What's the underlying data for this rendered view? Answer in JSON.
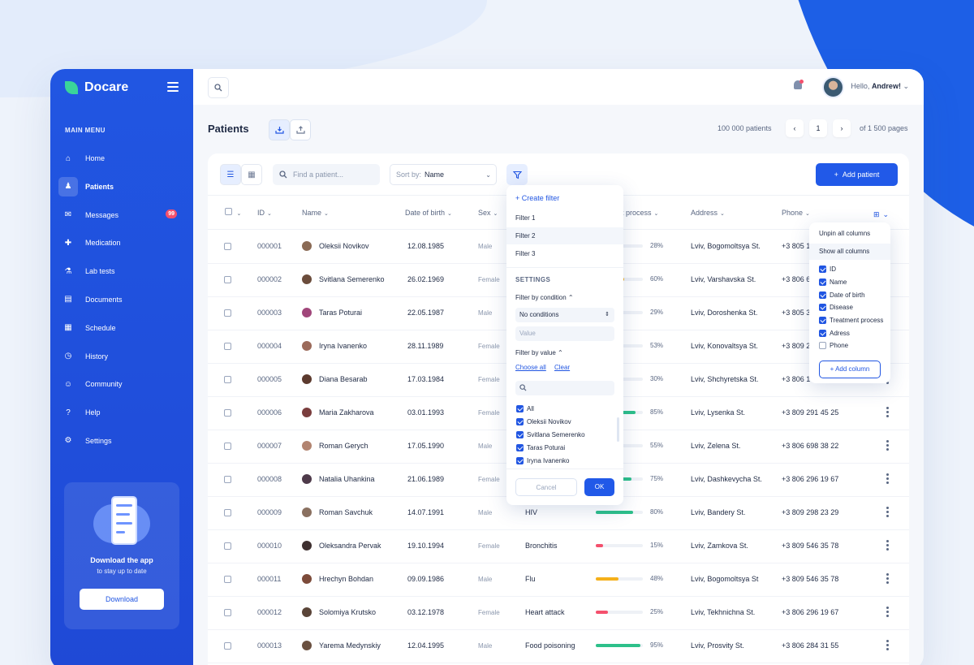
{
  "app": {
    "name": "Docare"
  },
  "sidebar": {
    "menu_title": "MAIN MENU",
    "items": [
      {
        "label": "Home",
        "icon": "home-icon",
        "glyph": "⌂"
      },
      {
        "label": "Patients",
        "icon": "patient-icon",
        "glyph": "♟",
        "active": true
      },
      {
        "label": "Messages",
        "icon": "mail-icon",
        "glyph": "✉",
        "badge": "99"
      },
      {
        "label": "Medication",
        "icon": "medication-icon",
        "glyph": "✚"
      },
      {
        "label": "Lab tests",
        "icon": "flask-icon",
        "glyph": "⚗"
      },
      {
        "label": "Documents",
        "icon": "document-icon",
        "glyph": "▤"
      },
      {
        "label": "Schedule",
        "icon": "calendar-icon",
        "glyph": "▦"
      },
      {
        "label": "History",
        "icon": "history-icon",
        "glyph": "◷"
      },
      {
        "label": "Community",
        "icon": "community-icon",
        "glyph": "☺"
      },
      {
        "label": "Help",
        "icon": "help-icon",
        "glyph": "?"
      },
      {
        "label": "Settings",
        "icon": "gear-icon",
        "glyph": "⚙"
      }
    ],
    "promo": {
      "title": "Download the app",
      "subtitle": "to stay up to date",
      "button": "Download"
    }
  },
  "topbar": {
    "greeting": "Hello,",
    "user": "Andrew!"
  },
  "page": {
    "title": "Patients",
    "count": "100 000 patients",
    "current_page": "1",
    "of_pages": "of 1 500 pages"
  },
  "toolbar": {
    "search_placeholder": "Find a patient...",
    "sort_label": "Sort by:",
    "sort_value": "Name",
    "add_button": "Add patient"
  },
  "table": {
    "columns": {
      "id": "ID",
      "name": "Name",
      "dob": "Date of birth",
      "sex": "Sex",
      "process": "nt process",
      "address": "Address",
      "phone": "Phone"
    },
    "rows": [
      {
        "id": "000001",
        "name": "Oleksii Novikov",
        "dob": "12.08.1985",
        "sex": "Male",
        "disease": "",
        "pct": 28,
        "pct_label": "28%",
        "color": "#f4506d",
        "address": "Lviv, Bogomoltsya St.",
        "phone": "+3 805 1",
        "ava": "#8a6a55"
      },
      {
        "id": "000002",
        "name": "Svitlana Semerenko",
        "dob": "26.02.1969",
        "sex": "Female",
        "disease": "",
        "pct": 60,
        "pct_label": "60%",
        "color": "#f5b01a",
        "address": "Lviv, Varshavska St.",
        "phone": "+3 806 6",
        "ava": "#6b4c3b"
      },
      {
        "id": "000003",
        "name": "Taras Poturai",
        "dob": "22.05.1987",
        "sex": "Male",
        "disease": "",
        "pct": 29,
        "pct_label": "29%",
        "color": "#f4506d",
        "address": "Lviv, Doroshenka St.",
        "phone": "+3 805 3",
        "ava": "#a0467a"
      },
      {
        "id": "000004",
        "name": "Iryna Ivanenko",
        "dob": "28.11.1989",
        "sex": "Female",
        "disease": "",
        "pct": 53,
        "pct_label": "53%",
        "color": "#f5b01a",
        "address": "Lviv, Konovaltsya St.",
        "phone": "+3 809 2",
        "ava": "#9b6a5a"
      },
      {
        "id": "000005",
        "name": "Diana Besarab",
        "dob": "17.03.1984",
        "sex": "Female",
        "disease": "",
        "pct": 30,
        "pct_label": "30%",
        "color": "#f4506d",
        "address": "Lviv, Shchyretska St.",
        "phone": "+3 806 1",
        "ava": "#5c3a2e"
      },
      {
        "id": "000006",
        "name": "Maria Zakharova",
        "dob": "03.01.1993",
        "sex": "Female",
        "disease": "",
        "pct": 85,
        "pct_label": "85%",
        "color": "#2dc08a",
        "address": "Lviv, Lysenka St.",
        "phone": "+3 809 291 45 25",
        "ava": "#7a3d3d"
      },
      {
        "id": "000007",
        "name": "Roman Gerych",
        "dob": "17.05.1990",
        "sex": "Male",
        "disease": "",
        "pct": 55,
        "pct_label": "55%",
        "color": "#f5b01a",
        "address": "Lviv, Zelena St.",
        "phone": "+3 806 698 38 22",
        "ava": "#b28470"
      },
      {
        "id": "000008",
        "name": "Natalia Uhankina",
        "dob": "21.06.1989",
        "sex": "Female",
        "disease": "",
        "pct": 75,
        "pct_label": "75%",
        "color": "#2dc08a",
        "address": "Lviv, Dashkevycha St.",
        "phone": "+3 806 296 19 67",
        "ava": "#4e3a4a"
      },
      {
        "id": "000009",
        "name": "Roman Savchuk",
        "dob": "14.07.1991",
        "sex": "Male",
        "disease": "HIV",
        "pct": 80,
        "pct_label": "80%",
        "color": "#2dc08a",
        "address": "Lviv, Bandery St.",
        "phone": "+3 809 298 23 29",
        "ava": "#8a7060"
      },
      {
        "id": "000010",
        "name": "Oleksandra Pervak",
        "dob": "19.10.1994",
        "sex": "Female",
        "disease": "Bronchitis",
        "pct": 15,
        "pct_label": "15%",
        "color": "#f4506d",
        "address": "Lviv, Zamkova St.",
        "phone": "+3 809 546 35 78",
        "ava": "#3e3030"
      },
      {
        "id": "000011",
        "name": "Hrechyn Bohdan",
        "dob": "09.09.1986",
        "sex": "Male",
        "disease": "Flu",
        "pct": 48,
        "pct_label": "48%",
        "color": "#f5b01a",
        "address": "Lviv, Bogomoltsya St",
        "phone": "+3 809 546 35 78",
        "ava": "#7c4b3a"
      },
      {
        "id": "000012",
        "name": "Solomiya Krutsko",
        "dob": "03.12.1978",
        "sex": "Female",
        "disease": "Heart attack",
        "pct": 25,
        "pct_label": "25%",
        "color": "#f4506d",
        "address": "Lviv, Tekhnichna St.",
        "phone": "+3 806 296 19 67",
        "ava": "#5a4438"
      },
      {
        "id": "000013",
        "name": "Yarema Medynskiy",
        "dob": "12.04.1995",
        "sex": "Male",
        "disease": "Food poisoning",
        "pct": 95,
        "pct_label": "95%",
        "color": "#2dc08a",
        "address": "Lviv, Prosvity St.",
        "phone": "+3 806 284 31 55",
        "ava": "#6a5040"
      }
    ]
  },
  "filter_popup": {
    "create": "Create filter",
    "filters": [
      "Filter 1",
      "Filter 2",
      "Filter 3"
    ],
    "settings": "SETTINGS",
    "by_condition": "Filter by condition",
    "condition_value": "No conditions",
    "value_placeholder": "Value",
    "by_value": "Filter by value",
    "choose_all": "Choose all",
    "clear": "Clear",
    "values": [
      "All",
      "Oleksii Novikov",
      "Svitlana Semerenko",
      "Taras Poturai",
      "Iryna Ivanenko"
    ],
    "cancel": "Cancel",
    "ok": "OK"
  },
  "columns_popup": {
    "unpin": "Unpin all columns",
    "show": "Show all columns",
    "columns": [
      {
        "label": "ID",
        "checked": true
      },
      {
        "label": "Name",
        "checked": true
      },
      {
        "label": "Date of birth",
        "checked": true
      },
      {
        "label": "Disease",
        "checked": true
      },
      {
        "label": "Treatment process",
        "checked": true
      },
      {
        "label": "Adress",
        "checked": true
      },
      {
        "label": "Phone",
        "checked": false
      }
    ],
    "add": "Add column"
  }
}
